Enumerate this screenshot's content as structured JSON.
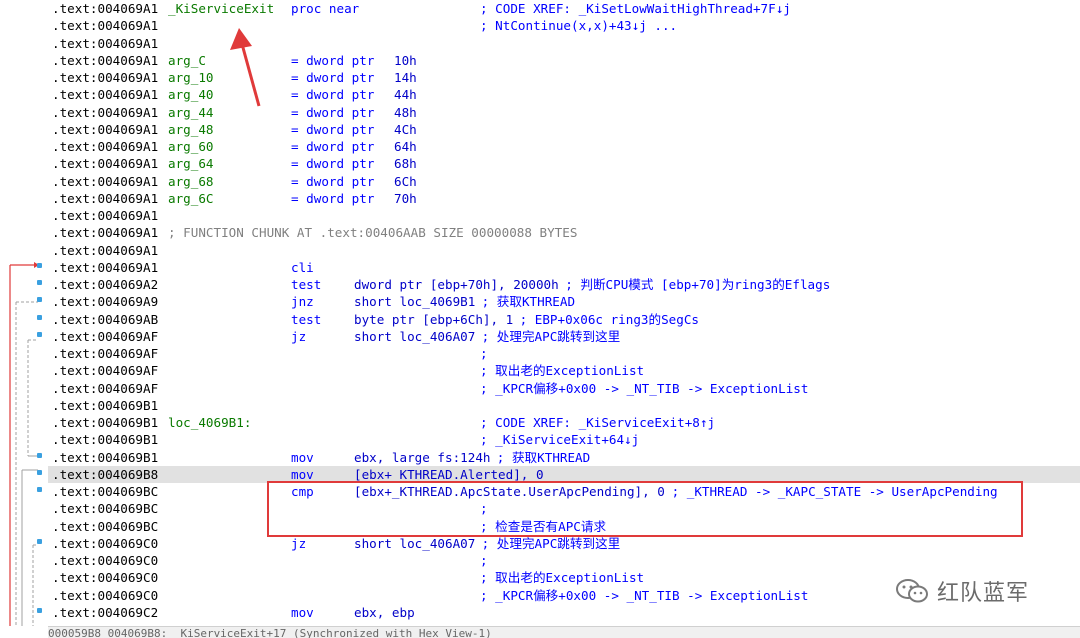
{
  "lines": [
    {
      "addr": ".text:004069A1",
      "name": "_KiServiceExit",
      "mn": "proc near",
      "op": "",
      "comment": "; CODE XREF: _KiSetLowWaitHighThread+7F↓j"
    },
    {
      "addr": ".text:004069A1",
      "name": "",
      "mn": "",
      "op": "",
      "comment": "; NtContinue(x,x)+43↓j ..."
    },
    {
      "addr": ".text:004069A1",
      "name": "",
      "mn": "",
      "op": "",
      "comment": ""
    },
    {
      "addr": ".text:004069A1",
      "name": "arg_C",
      "mn": "= dword ptr",
      "op": "10h",
      "comment": ""
    },
    {
      "addr": ".text:004069A1",
      "name": "arg_10",
      "mn": "= dword ptr",
      "op": "14h",
      "comment": ""
    },
    {
      "addr": ".text:004069A1",
      "name": "arg_40",
      "mn": "= dword ptr",
      "op": "44h",
      "comment": ""
    },
    {
      "addr": ".text:004069A1",
      "name": "arg_44",
      "mn": "= dword ptr",
      "op": "48h",
      "comment": ""
    },
    {
      "addr": ".text:004069A1",
      "name": "arg_48",
      "mn": "= dword ptr",
      "op": "4Ch",
      "comment": ""
    },
    {
      "addr": ".text:004069A1",
      "name": "arg_60",
      "mn": "= dword ptr",
      "op": "64h",
      "comment": ""
    },
    {
      "addr": ".text:004069A1",
      "name": "arg_64",
      "mn": "= dword ptr",
      "op": "68h",
      "comment": ""
    },
    {
      "addr": ".text:004069A1",
      "name": "arg_68",
      "mn": "= dword ptr",
      "op": "6Ch",
      "comment": ""
    },
    {
      "addr": ".text:004069A1",
      "name": "arg_6C",
      "mn": "= dword ptr",
      "op": "70h",
      "comment": ""
    },
    {
      "addr": ".text:004069A1",
      "name": "",
      "mn": "",
      "op": "",
      "comment": ""
    },
    {
      "addr": ".text:004069A1",
      "name": "",
      "mn": "",
      "op": "",
      "comment": "; FUNCTION CHUNK AT .text:00406AAB SIZE 00000088 BYTES"
    },
    {
      "addr": ".text:004069A1",
      "name": "",
      "mn": "",
      "op": "",
      "comment": ""
    },
    {
      "addr": ".text:004069A1",
      "name": "",
      "mn": "cli",
      "op": "",
      "comment": ""
    },
    {
      "addr": ".text:004069A2",
      "name": "",
      "mn": "test",
      "op": "dword ptr [ebp+70h], 20000h",
      "comment": "; 判断CPU模式 [ebp+70]为ring3的Eflags"
    },
    {
      "addr": ".text:004069A9",
      "name": "",
      "mn": "jnz",
      "op": "short loc_4069B1",
      "comment": "; 获取KTHREAD"
    },
    {
      "addr": ".text:004069AB",
      "name": "",
      "mn": "test",
      "op": "byte ptr [ebp+6Ch], 1",
      "comment": "; EBP+0x06c ring3的SegCs"
    },
    {
      "addr": ".text:004069AF",
      "name": "",
      "mn": "jz",
      "op": "short loc_406A07",
      "comment": "; 处理完APC跳转到这里"
    },
    {
      "addr": ".text:004069AF",
      "name": "",
      "mn": "",
      "op": "",
      "comment": ";"
    },
    {
      "addr": ".text:004069AF",
      "name": "",
      "mn": "",
      "op": "",
      "comment": "; 取出老的ExceptionList"
    },
    {
      "addr": ".text:004069AF",
      "name": "",
      "mn": "",
      "op": "",
      "comment": "; _KPCR偏移+0x00 -> _NT_TIB -> ExceptionList"
    },
    {
      "addr": ".text:004069B1",
      "name": "",
      "mn": "",
      "op": "",
      "comment": ""
    },
    {
      "addr": ".text:004069B1",
      "name": "loc_4069B1:",
      "mn": "",
      "op": "",
      "comment": "; CODE XREF: _KiServiceExit+8↑j"
    },
    {
      "addr": ".text:004069B1",
      "name": "",
      "mn": "",
      "op": "",
      "comment": "; _KiServiceExit+64↓j"
    },
    {
      "addr": ".text:004069B1",
      "name": "",
      "mn": "mov",
      "op": "ebx, large fs:124h",
      "comment": "; 获取KTHREAD"
    },
    {
      "addr": ".text:004069B8",
      "name": "",
      "mn": "mov",
      "op": "[ebx+_KTHREAD.Alerted], 0",
      "comment": ""
    },
    {
      "addr": ".text:004069BC",
      "name": "",
      "mn": "cmp",
      "op": "[ebx+_KTHREAD.ApcState.UserApcPending], 0",
      "comment": "; _KTHREAD -> _KAPC_STATE -> UserApcPending"
    },
    {
      "addr": ".text:004069BC",
      "name": "",
      "mn": "",
      "op": "",
      "comment": ";"
    },
    {
      "addr": ".text:004069BC",
      "name": "",
      "mn": "",
      "op": "",
      "comment": "; 检查是否有APC请求"
    },
    {
      "addr": ".text:004069C0",
      "name": "",
      "mn": "jz",
      "op": "short loc_406A07",
      "comment": "; 处理完APC跳转到这里"
    },
    {
      "addr": ".text:004069C0",
      "name": "",
      "mn": "",
      "op": "",
      "comment": ";"
    },
    {
      "addr": ".text:004069C0",
      "name": "",
      "mn": "",
      "op": "",
      "comment": "; 取出老的ExceptionList"
    },
    {
      "addr": ".text:004069C0",
      "name": "",
      "mn": "",
      "op": "",
      "comment": "; _KPCR偏移+0x00 -> _NT_TIB -> ExceptionList"
    },
    {
      "addr": ".text:004069C2",
      "name": "",
      "mn": "mov",
      "op": "ebx, ebp",
      "comment": ""
    }
  ],
  "selected_index": 27,
  "highlight_box_indices": [
    28,
    29,
    30
  ],
  "status_text": "000059B8 004069B8: _KiServiceExit+17 (Synchronized with Hex View-1)",
  "watermark": "红队蓝军",
  "colors": {
    "name": "#0a7a00",
    "mnemonic": "#0000ff",
    "comment": "#0000ff",
    "highlight_box": "#e03a3a",
    "arrow": "#e03a3a"
  }
}
